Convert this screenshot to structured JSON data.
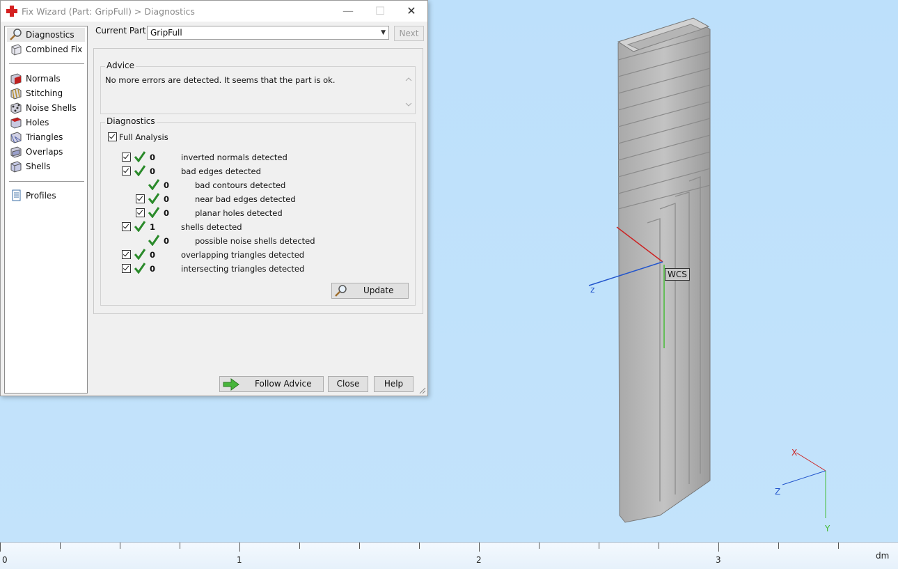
{
  "window": {
    "title": "Fix Wizard (Part: GripFull) > Diagnostics",
    "minimize_glyph": "—",
    "maximize_glyph": "☐",
    "close_glyph": "✕"
  },
  "nav": {
    "items": [
      {
        "label": "Diagnostics",
        "icon": "magnifier-icon",
        "selected": true
      },
      {
        "label": "Combined Fix",
        "icon": "combined-fix-icon"
      },
      {
        "label": "Normals",
        "icon": "normals-icon"
      },
      {
        "label": "Stitching",
        "icon": "stitching-icon"
      },
      {
        "label": "Noise Shells",
        "icon": "noise-shells-icon"
      },
      {
        "label": "Holes",
        "icon": "holes-icon"
      },
      {
        "label": "Triangles",
        "icon": "triangles-icon"
      },
      {
        "label": "Overlaps",
        "icon": "overlaps-icon"
      },
      {
        "label": "Shells",
        "icon": "shells-icon"
      },
      {
        "label": "Profiles",
        "icon": "profiles-icon"
      }
    ]
  },
  "part": {
    "label": "Current Part:",
    "value": "GripFull",
    "next_label": "Next"
  },
  "advice": {
    "legend": "Advice",
    "text": "No more errors are detected. It seems that the part is ok."
  },
  "diagnostics": {
    "legend": "Diagnostics",
    "full_analysis_label": "Full Analysis",
    "rows": [
      {
        "count": "0",
        "label": "inverted normals detected"
      },
      {
        "count": "0",
        "label": "bad edges detected"
      },
      {
        "count": "0",
        "label": "bad contours detected"
      },
      {
        "count": "0",
        "label": "near bad edges detected"
      },
      {
        "count": "0",
        "label": "planar holes detected"
      },
      {
        "count": "1",
        "label": "shells detected"
      },
      {
        "count": "0",
        "label": "possible noise shells detected"
      },
      {
        "count": "0",
        "label": "overlapping triangles detected"
      },
      {
        "count": "0",
        "label": "intersecting triangles detected"
      }
    ],
    "update_label": "Update"
  },
  "buttons": {
    "follow_advice": "Follow Advice",
    "close": "Close",
    "help": "Help"
  },
  "viewport": {
    "wcs_label": "WCS",
    "axis_x": "X",
    "axis_y": "Y",
    "axis_z": "Z",
    "local_axis_z": "z",
    "colors": {
      "x": "#cc2222",
      "y": "#44bb33",
      "z": "#2255cc",
      "background": "#bfe0fb"
    }
  },
  "ruler": {
    "labels": [
      "0",
      "1",
      "2",
      "3"
    ],
    "unit": "dm"
  }
}
